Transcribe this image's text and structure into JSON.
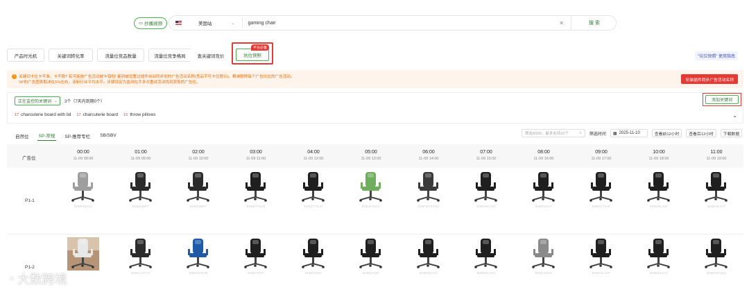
{
  "search": {
    "follow_label": "抄播视频",
    "site": "美国站",
    "keyword": "gaming chair",
    "search_label": "搜 索"
  },
  "tabs": {
    "items": [
      "产品时光机",
      "关键词转化率",
      "流量位竞品数量",
      "流量位竞争格局",
      "查关键词竞价"
    ],
    "active": "坑位快照",
    "badge": "平台必备",
    "guide": "\"坑位快照\" 使用指南"
  },
  "warning": {
    "line1": "关键词卡位卡不准、卡不稳? 有可能是广告活动被卡错啦! 鉴别被设置过插件自动同步创的广告活动名称(竞品不可卡位提示)。精准删除每个广告坑位的广告活动。",
    "line2": "SP的广告图表取决在5%左右，该新行业平均水平。步骤设定为监测在手多次重试活动找到获取的广告位。",
    "button": "安装插件同步广告活动名称"
  },
  "monitor": {
    "select_label": "正在监控的关键词",
    "count_text": "3个（7天内到期0个）",
    "add_button": "添加关键词",
    "keywords": [
      {
        "num": "17",
        "text": "charcuterie board with lid"
      },
      {
        "num": "17",
        "text": "charcuterie board"
      },
      {
        "num": "15",
        "text": "throw pillows"
      }
    ]
  },
  "subtabs": {
    "items": [
      "自然位",
      "SP-常规",
      "SP-推荐专栏",
      "SB/SBV"
    ],
    "active_index": 1
  },
  "tools": {
    "asin_placeholder": "筛选ASIN，最多支持10个",
    "time_label": "筛选时间",
    "date": "2025-11-10",
    "prev_btn": "查看前12小时",
    "next_btn": "查看后12小时",
    "download_btn": "下载数据"
  },
  "grid": {
    "position_header": "广告位",
    "columns": [
      {
        "time": "00:00",
        "date": "11-09 08:00"
      },
      {
        "time": "01:00",
        "date": "11-09 09:00"
      },
      {
        "time": "02:00",
        "date": "11-09 10:00"
      },
      {
        "time": "03:00",
        "date": "11-09 11:00"
      },
      {
        "time": "04:00",
        "date": "11-09 12:00"
      },
      {
        "time": "05:00",
        "date": "11-09 13:00"
      },
      {
        "time": "06:00",
        "date": "11-09 14:00"
      },
      {
        "time": "07:00",
        "date": "11-09 15:00"
      },
      {
        "time": "08:00",
        "date": "11-09 16:00"
      },
      {
        "time": "09:00",
        "date": "11-09 17:00"
      },
      {
        "time": "10:00",
        "date": "11-09 18:00"
      },
      {
        "time": "11:00",
        "date": "11-09 19:00"
      }
    ],
    "rows": [
      {
        "label": "P1-1",
        "cells": [
          {
            "asin": "B0BRD6K4I",
            "color": "#9e9e9e"
          },
          {
            "asin": "B0B5QBFF",
            "color": "#2b2b2b"
          },
          {
            "asin": "B0B5QBFF",
            "color": "#2b2b2b"
          },
          {
            "asin": "B0BD7T5JH",
            "color": "#1f1f1f"
          },
          {
            "asin": "B0BD7T5JH",
            "color": "#1f1f1f"
          },
          {
            "asin": "B0BJFJNCV",
            "color": "#6fae5f"
          },
          {
            "asin": "B0BTKF6G9V",
            "color": "#3a3a3a"
          },
          {
            "asin": "B0BK5KTZR",
            "color": "#1f1f1f"
          },
          {
            "asin": "B0BD1K1T",
            "color": "#1f1f1f"
          },
          {
            "asin": "B0BD7T5JH",
            "color": "#1f1f1f"
          },
          {
            "asin": "B0BK5LJHF",
            "color": "#1f1f1f"
          },
          {
            "asin": "B0BK5LT4T",
            "color": "#1f1f1f"
          }
        ]
      },
      {
        "label": "P1-2",
        "cells": [
          {
            "asin": "",
            "color": "#c9a98a",
            "photo": "photo-thumbnail"
          },
          {
            "asin": "B0BKUJKCT",
            "color": "#2b2b2b"
          },
          {
            "asin": "B0BKD0T39",
            "color": "#1e5aa8"
          },
          {
            "asin": "B0BD7N5F",
            "color": "#1f1f1f"
          },
          {
            "asin": "B0BD7N5F",
            "color": "#1f1f1f"
          },
          {
            "asin": "B0BD7N5F",
            "color": "#1f1f1f"
          },
          {
            "asin": "B0BK5KL0A",
            "color": "#1f1f1f"
          },
          {
            "asin": "B0BK5L1FU",
            "color": "#1f1f1f"
          },
          {
            "asin": "B0BK1D0G",
            "color": "#8a8a8a"
          },
          {
            "asin": "B0BK5LJHF",
            "color": "#1f1f1f"
          },
          {
            "asin": "B0BK5LK1T",
            "color": "#1f1f1f"
          },
          {
            "asin": "B0BK5PQQJ",
            "color": "#1f1f1f"
          }
        ]
      }
    ]
  },
  "watermark": "大数跨境"
}
